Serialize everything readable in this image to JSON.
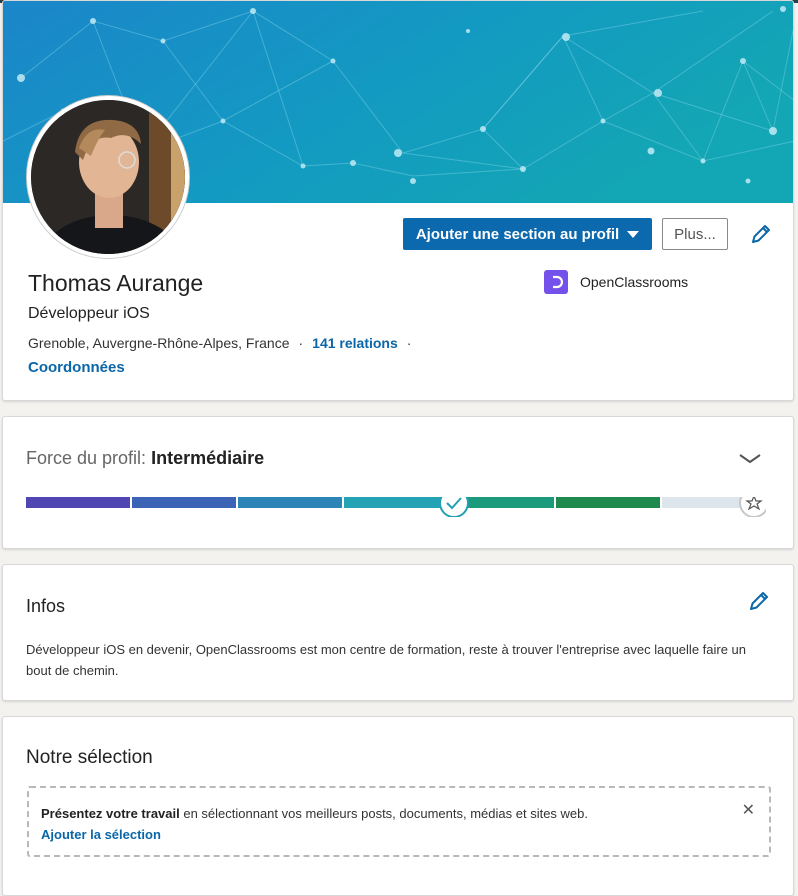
{
  "profile": {
    "name": "Thomas Aurange",
    "headline": "Développeur iOS",
    "location": "Grenoble, Auvergne-Rhône-Alpes, France",
    "connections": "141 relations",
    "contact_link": "Coordonnées",
    "company": "OpenClassrooms",
    "company_logo_color": "#7451eb",
    "add_section_button": "Ajouter une section au profil",
    "more_button": "Plus...",
    "banner_color": "#1a8fc9",
    "edit_icon": "pencil-icon"
  },
  "strength": {
    "label": "Force du profil:",
    "level": "Intermédiaire",
    "progress_segments_filled": 4,
    "progress_segments_total": 7,
    "segment_colors": [
      "#5046b3",
      "#3b63b6",
      "#2c85b6",
      "#24a3b4",
      "#1b9b7b",
      "#1f8a4e",
      "#dce6ec"
    ],
    "toggle_icon": "chevron-down-icon",
    "goal_icon": "star-icon"
  },
  "infos": {
    "title": "Infos",
    "text": "Développeur iOS en devenir, OpenClassrooms est mon centre de formation, reste à trouver l'entreprise avec laquelle faire un bout de chemin."
  },
  "featured": {
    "title": "Notre sélection",
    "lead_bold": "Présentez votre travail",
    "lead_rest": " en sélectionnant vos meilleurs posts, documents, médias et sites web.",
    "add_link": "Ajouter la sélection",
    "close_glyph": "✕"
  }
}
